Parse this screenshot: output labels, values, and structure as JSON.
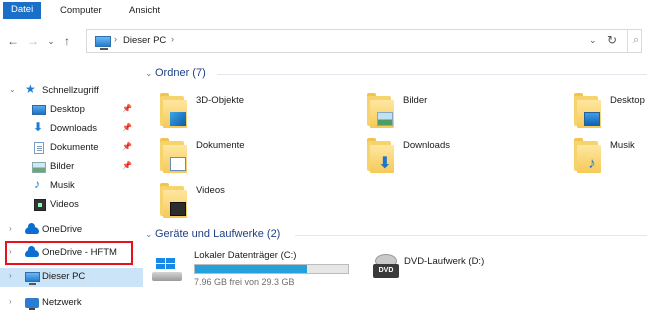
{
  "ribbon": {
    "tabs": [
      {
        "label": "Datei"
      },
      {
        "label": "Computer"
      },
      {
        "label": "Ansicht"
      }
    ]
  },
  "address": {
    "crumb": "Dieser PC",
    "icon": "pc-icon"
  },
  "sidebar": {
    "quick_access": "Schnellzugriff",
    "items": [
      {
        "label": "Desktop",
        "icon": "desktop-icon",
        "pinned": true
      },
      {
        "label": "Downloads",
        "icon": "download-icon",
        "pinned": true
      },
      {
        "label": "Dokumente",
        "icon": "document-icon",
        "pinned": true
      },
      {
        "label": "Bilder",
        "icon": "pictures-icon",
        "pinned": true
      },
      {
        "label": "Musik",
        "icon": "music-icon",
        "pinned": false
      },
      {
        "label": "Videos",
        "icon": "video-icon",
        "pinned": false
      }
    ],
    "onedrive": "OneDrive",
    "onedrive_hftm": "OneDrive - HFTM",
    "this_pc": "Dieser PC",
    "network": "Netzwerk"
  },
  "main": {
    "folders_header": "Ordner (7)",
    "folders": [
      {
        "name": "3D-Objekte",
        "icon": "3d-objects-icon"
      },
      {
        "name": "Bilder",
        "icon": "pictures-folder-icon"
      },
      {
        "name": "Desktop",
        "icon": "desktop-folder-icon"
      },
      {
        "name": "Dokumente",
        "icon": "documents-folder-icon"
      },
      {
        "name": "Downloads",
        "icon": "downloads-folder-icon"
      },
      {
        "name": "Musik",
        "icon": "music-folder-icon"
      },
      {
        "name": "Videos",
        "icon": "videos-folder-icon"
      }
    ],
    "drives_header": "Geräte und Laufwerke (2)",
    "drives": [
      {
        "name": "Lokaler Datenträger (C:)",
        "free": "7.96 GB frei von 29.3 GB",
        "used_fraction": 0.73
      },
      {
        "name": "DVD-Laufwerk (D:)",
        "label": "DVD"
      }
    ]
  },
  "colors": {
    "accent": "#1a6fc9",
    "highlight": "#e8101a",
    "selected": "#cce4f7",
    "usage_bar": "#26a0da"
  }
}
